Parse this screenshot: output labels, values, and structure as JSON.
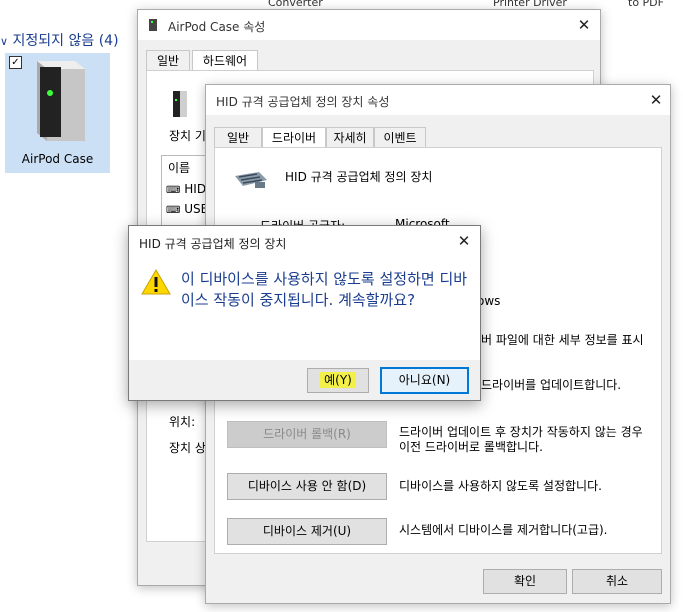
{
  "background": {
    "top_cut_left": "Converter",
    "top_cut_mid": "Printer Driver",
    "top_cut_right": "to PDF",
    "group_header": "지정되지 않음 (4)",
    "tile_label": "AirPod Case",
    "tile_check": "✓"
  },
  "airpod_window": {
    "title": "AirPod Case 속성",
    "tabs": [
      "일반",
      "하드웨어"
    ],
    "device_label": "장치 기",
    "list_header": "이름",
    "list_items": [
      "HID",
      "USB"
    ],
    "location_label": "위치:",
    "status_label": "장치 상"
  },
  "hid_window": {
    "title": "HID 규격 공급업체 정의 장치 속성",
    "tabs": [
      "일반",
      "드라이버",
      "자세히",
      "이벤트"
    ],
    "device_name": "HID 규격 공급업체 정의 장치",
    "provider_label": "드라이버 공급자:",
    "provider_value": "Microsoft",
    "partial_value": "ows",
    "partial_desc_1": "버 파일에 대한 세부 정보를 표시",
    "partial_desc_2": "드라이버를 업데이트합니다.",
    "rollback_button": "드라이버 롤백(R)",
    "rollback_desc": "드라이버 업데이트 후 장치가 작동하지 않는 경우 이전 드라이버로 롤백합니다.",
    "disable_button": "디바이스 사용 안 함(D)",
    "disable_desc": "디바이스를 사용하지 않도록 설정합니다.",
    "remove_button": "디바이스 제거(U)",
    "remove_desc": "시스템에서 디바이스를 제거합니다(고급).",
    "ok_button": "확인",
    "cancel_button": "취소"
  },
  "dialog": {
    "title": "HID 규격 공급업체 정의 장치",
    "message": "이 디바이스를 사용하지 않도록 설정하면 디바이스 작동이 중지됩니다. 계속할까요?",
    "yes_button": "예(Y)",
    "no_button": "아니요(N)",
    "highlight_color": "#f4f04a"
  }
}
